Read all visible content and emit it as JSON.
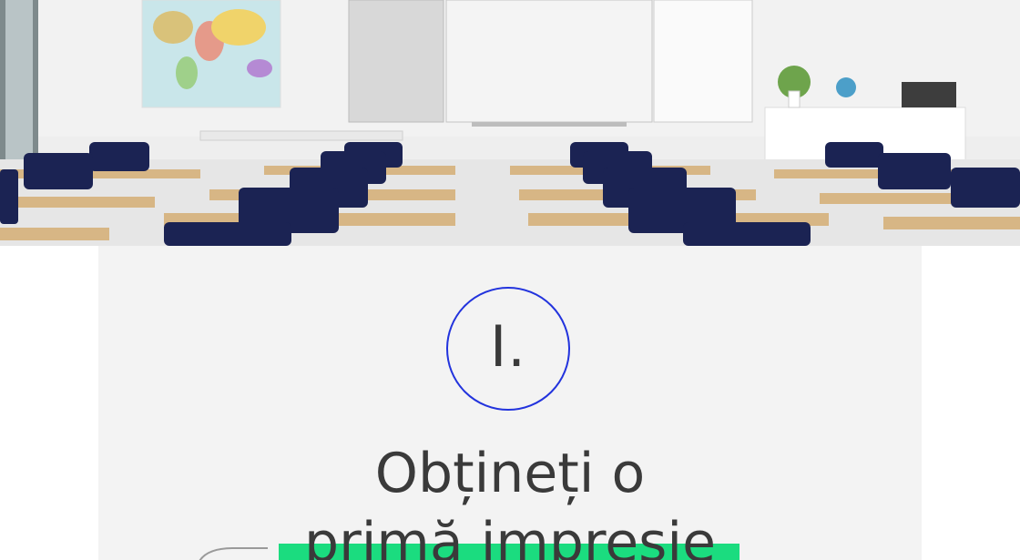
{
  "step": {
    "number": "I."
  },
  "heading": {
    "line1": "Obțineți o",
    "line2": "primă impresie"
  },
  "colors": {
    "accent_ring": "#2233dd",
    "highlight": "#1bdc7f",
    "card_background": "#f3f3f3",
    "text": "#3a3a3a"
  },
  "icons": {
    "hero": "classroom-photo",
    "decoration": "curved-line-icon"
  }
}
